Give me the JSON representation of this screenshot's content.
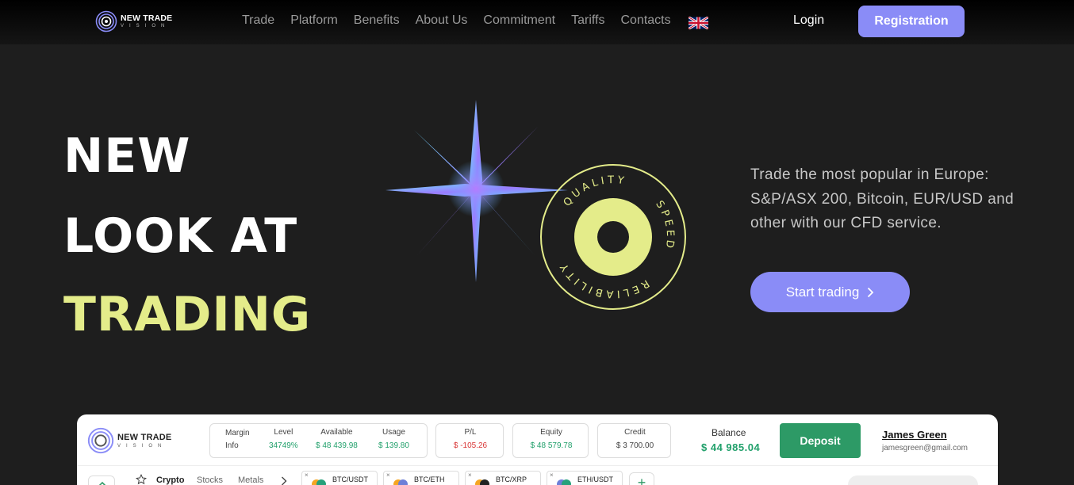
{
  "brand": {
    "name_line1": "NEW TRADE",
    "name_line2": "VISION"
  },
  "nav": {
    "items": [
      "Trade",
      "Platform",
      "Benefits",
      "About Us",
      "Commitment",
      "Tariffs",
      "Contacts"
    ]
  },
  "header": {
    "login": "Login",
    "register": "Registration"
  },
  "hero": {
    "title_line1": "NEW",
    "title_line2": "LOOK AT",
    "title_line3": "TRADING",
    "badge_words": [
      "QUALITY",
      "SPEED",
      "RELIABILITY"
    ],
    "description": "Trade the most popular in Europe: S&P/ASX 200, Bitcoin, EUR/USD and other with our CFD service.",
    "cta": "Start trading"
  },
  "colors": {
    "accent": "#8a8cf7",
    "highlight": "#e4ec8a",
    "positive": "#21a06b",
    "negative": "#d93636",
    "background": "#1e1e1e"
  },
  "platform": {
    "margin": {
      "label_line1": "Margin",
      "label_line2": "Info",
      "level_label": "Level",
      "level_value": "34749%",
      "available_label": "Available",
      "available_value": "$ 48 439.98",
      "usage_label": "Usage",
      "usage_value": "$ 139.80"
    },
    "pl": {
      "label": "P/L",
      "value": "$ -105.26"
    },
    "equity": {
      "label": "Equity",
      "value": "$ 48 579.78"
    },
    "credit": {
      "label": "Credit",
      "value": "$ 3 700.00"
    },
    "balance": {
      "label": "Balance",
      "value": "$ 44 985.04"
    },
    "deposit": "Deposit",
    "user": {
      "name": "James Green",
      "email": "jamesgreen@gmail.com"
    },
    "categories": [
      "Crypto",
      "Stocks",
      "Metals"
    ],
    "pairs": [
      "BTC/USDT",
      "BTC/ETH",
      "BTC/XRP",
      "ETH/USDT"
    ]
  }
}
